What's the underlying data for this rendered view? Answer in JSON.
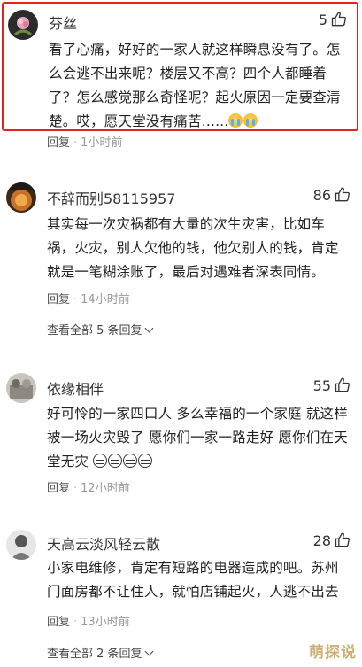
{
  "comments": [
    {
      "username": "芬丝",
      "likes": "5",
      "text": "看了心痛，好好的一家人就这样瞬息没有了。怎么会逃不出来呢？楼层又不高？四个人都睡着了？怎么感觉那么奇怪呢？起火原因一定要查清楚。哎，愿天堂没有痛苦......",
      "emoji": "crying-face-emoji",
      "reply_label": "回复",
      "time": "1小时前",
      "highlighted": true
    },
    {
      "username": "不辞而别58115957",
      "likes": "86",
      "text": "其实每一次灾祸都有大量的次生灾害，比如车祸，火灾，别人欠他的钱，他欠别人的钱，肯定就是一笔糊涂账了，最后对遇难者深表同情。",
      "reply_label": "回复",
      "time": "14小时前",
      "view_all": "查看全部 5 条回复"
    },
    {
      "username": "依缘相伴",
      "likes": "55",
      "text": "好可怜的一家四口人 多么幸福的一个家庭 就这样被一场火灾毁了 愿你们一家一路走好 愿你们在天堂无灾",
      "emoji": "crying-face-emoji",
      "reply_label": "回复",
      "time": "12小时前"
    },
    {
      "username": "天高云淡风轻云散",
      "likes": "28",
      "text": "小家电维修，肯定有短路的电器造成的吧。苏州门面房都不让住人，就怕店铺起火，人逃不出去",
      "reply_label": "回复",
      "time": "13小时前",
      "view_all": "查看全部 2 条回复"
    }
  ],
  "watermark": "萌探说",
  "colors": {
    "highlight_border": "#e0261b",
    "meta_text": "#999999",
    "body_text": "#222222"
  }
}
